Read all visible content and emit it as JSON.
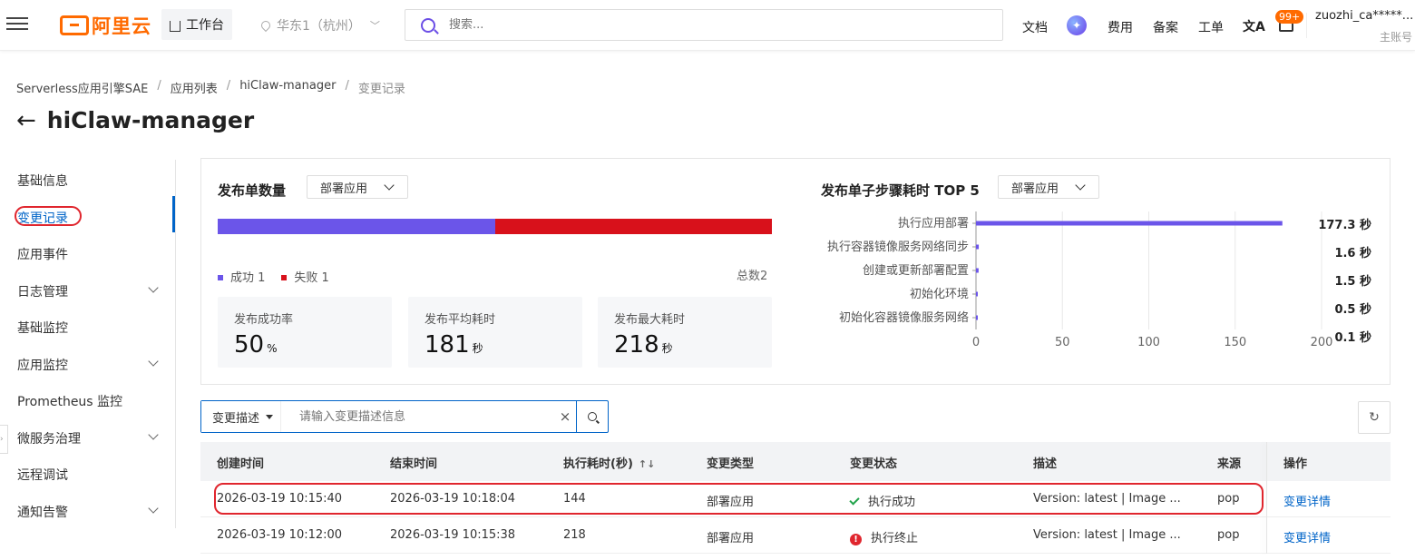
{
  "topbar": {
    "logo_text": "阿里云",
    "workbench": "工作台",
    "region": "华东1（杭州）",
    "search_placeholder": "搜索...",
    "nav": [
      "文档",
      "费用",
      "备案",
      "工单"
    ],
    "badge": "99+",
    "user": "zuozhi_ca*****...",
    "user_role": "主账号"
  },
  "breadcrumb": [
    "Serverless应用引擎SAE",
    "应用列表",
    "hiClaw-manager",
    "变更记录"
  ],
  "page_title": "hiClaw-manager",
  "sidenav": {
    "items": [
      {
        "label": "基础信息",
        "expandable": false
      },
      {
        "label": "变更记录",
        "expandable": false,
        "active": true
      },
      {
        "label": "应用事件",
        "expandable": false
      },
      {
        "label": "日志管理",
        "expandable": true
      },
      {
        "label": "基础监控",
        "expandable": false
      },
      {
        "label": "应用监控",
        "expandable": true
      },
      {
        "label": "Prometheus 监控",
        "expandable": false
      },
      {
        "label": "微服务治理",
        "expandable": true
      },
      {
        "label": "远程调试",
        "expandable": false
      },
      {
        "label": "通知告警",
        "expandable": true
      }
    ]
  },
  "stats": {
    "title": "发布单数量",
    "dropdown": "部署应用",
    "success_count": 1,
    "fail_count": 1,
    "legend_success": "成功 1",
    "legend_fail": "失败 1",
    "total": "总数2",
    "colors": {
      "success": "#6b55e9",
      "fail": "#d8111b"
    },
    "cards": [
      {
        "label": "发布成功率",
        "value": "50",
        "unit": "%"
      },
      {
        "label": "发布平均耗时",
        "value": "181",
        "unit": "秒"
      },
      {
        "label": "发布最大耗时",
        "value": "218",
        "unit": "秒"
      }
    ]
  },
  "chart_data": {
    "type": "bar",
    "orientation": "horizontal",
    "title": "发布单子步骤耗时 TOP 5",
    "categories": [
      "执行应用部署",
      "执行容器镜像服务网络同步",
      "创建或更新部署配置",
      "初始化环境",
      "初始化容器镜像服务网络"
    ],
    "values": [
      177.3,
      1.6,
      1.5,
      0.5,
      0.1
    ],
    "value_labels": [
      "177.3 秒",
      "1.6 秒",
      "1.5 秒",
      "0.5 秒",
      "0.1 秒"
    ],
    "xlim": [
      0,
      200
    ],
    "xticks": [
      "0",
      "50",
      "100",
      "150",
      "200"
    ],
    "color": "#6b55e9",
    "grid": true
  },
  "chart_dropdown": "部署应用",
  "filter": {
    "selector": "变更描述",
    "placeholder": "请输入变更描述信息",
    "clear": "×"
  },
  "table": {
    "columns": [
      "创建时间",
      "结束时间",
      "执行耗时(秒)",
      "变更类型",
      "变更状态",
      "描述",
      "来源",
      "操作"
    ],
    "sort_icon": "↑↓",
    "rows": [
      {
        "created": "2026-03-19 10:15:40",
        "ended": "2026-03-19 10:18:04",
        "duration": "144",
        "type": "部署应用",
        "status": "执行成功",
        "status_kind": "success",
        "desc": "Version: latest | Image ...",
        "source": "pop",
        "action": "变更详情"
      },
      {
        "created": "2026-03-19 10:12:00",
        "ended": "2026-03-19 10:15:38",
        "duration": "218",
        "type": "部署应用",
        "status": "执行终止",
        "status_kind": "error",
        "desc": "Version: latest | Image ...",
        "source": "pop",
        "action": "变更详情"
      }
    ]
  }
}
